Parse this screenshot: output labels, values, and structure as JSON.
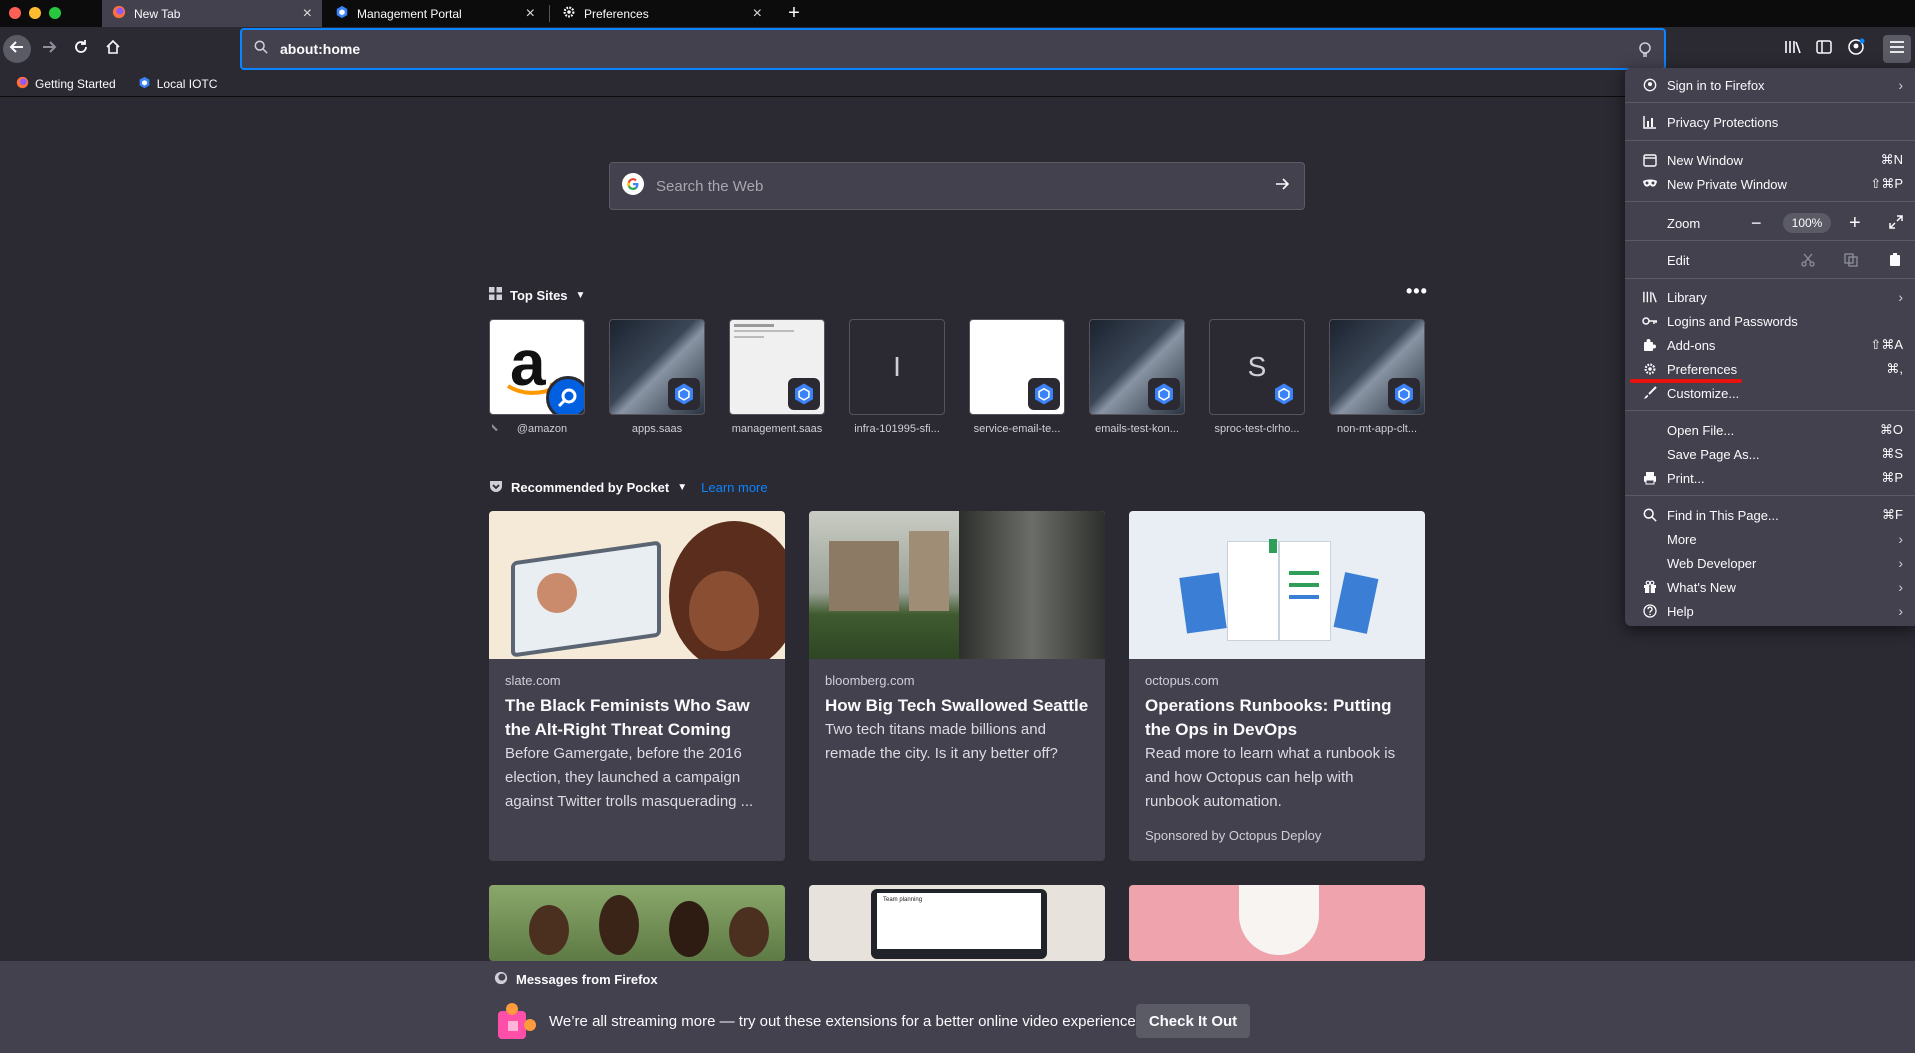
{
  "window": {
    "tabs": [
      {
        "label": "New Tab",
        "icon": "firefox-icon",
        "active": true
      },
      {
        "label": "Management Portal",
        "icon": "hexagon-icon",
        "active": false
      },
      {
        "label": "Preferences",
        "icon": "gear-icon",
        "active": false
      }
    ],
    "new_tab_symbol": "+",
    "close_symbol": "×"
  },
  "navbar": {
    "url": "about:home"
  },
  "bookmarks": [
    {
      "label": "Getting Started",
      "icon": "firefox-icon"
    },
    {
      "label": "Local IOTC",
      "icon": "hexagon-icon"
    }
  ],
  "newtab": {
    "search_placeholder": "Search the Web",
    "top_sites_label": "Top Sites",
    "top_sites": [
      {
        "label": "@amazon",
        "letter": "a",
        "kind": "amazon"
      },
      {
        "label": "apps.saas",
        "letter": "",
        "kind": "blur"
      },
      {
        "label": "management.saas",
        "letter": "",
        "kind": "page"
      },
      {
        "label": "infra-101995-sfi...",
        "letter": "I",
        "kind": "letter"
      },
      {
        "label": "service-email-te...",
        "letter": "",
        "kind": "white"
      },
      {
        "label": "emails-test-kon...",
        "letter": "",
        "kind": "blur"
      },
      {
        "label": "sproc-test-clrho...",
        "letter": "S",
        "kind": "letter"
      },
      {
        "label": "non-mt-app-clt...",
        "letter": "",
        "kind": "blur"
      }
    ],
    "pocket_label": "Recommended by Pocket",
    "learn_more": "Learn more",
    "stories": [
      {
        "source": "slate.com",
        "title": "The Black Feminists Who Saw the Alt-Right Threat Coming",
        "excerpt": "Before Gamergate, before the 2016 election, they launched a campaign against Twitter trolls masquerading ...",
        "sponsor": ""
      },
      {
        "source": "bloomberg.com",
        "title": "How Big Tech Swallowed Seattle",
        "excerpt": "Two tech titans made billions and remade the city. Is it any better off?",
        "sponsor": ""
      },
      {
        "source": "octopus.com",
        "title": "Operations Runbooks: Putting the Ops in DevOps",
        "excerpt": "Read more to learn what a runbook is and how Octopus can help with runbook automation.",
        "sponsor": "Sponsored by Octopus Deploy"
      }
    ],
    "laptop_screen_text": "Team planning"
  },
  "messages": {
    "header": "Messages from Firefox",
    "text": "We’re all streaming more — try out these extensions for a better online video experience.",
    "button": "Check It Out"
  },
  "menu": {
    "sign_in": "Sign in to Firefox",
    "privacy": "Privacy Protections",
    "new_window": "New Window",
    "new_window_sc": "⌘N",
    "new_private": "New Private Window",
    "new_private_sc": "⇧⌘P",
    "zoom": "Zoom",
    "zoom_minus": "−",
    "zoom_value": "100%",
    "zoom_plus": "+",
    "edit": "Edit",
    "library": "Library",
    "logins": "Logins and Passwords",
    "addons": "Add-ons",
    "addons_sc": "⇧⌘A",
    "preferences": "Preferences",
    "preferences_sc": "⌘,",
    "customize": "Customize...",
    "open_file": "Open File...",
    "open_file_sc": "⌘O",
    "save_page": "Save Page As...",
    "save_page_sc": "⌘S",
    "print": "Print...",
    "print_sc": "⌘P",
    "find": "Find in This Page...",
    "find_sc": "⌘F",
    "more": "More",
    "web_dev": "Web Developer",
    "whats_new": "What's New",
    "help": "Help"
  },
  "colors": {
    "accent": "#0a84ff",
    "annotation_underline": "#e8130f",
    "background": "#2b2a33",
    "panel": "#42414d"
  }
}
